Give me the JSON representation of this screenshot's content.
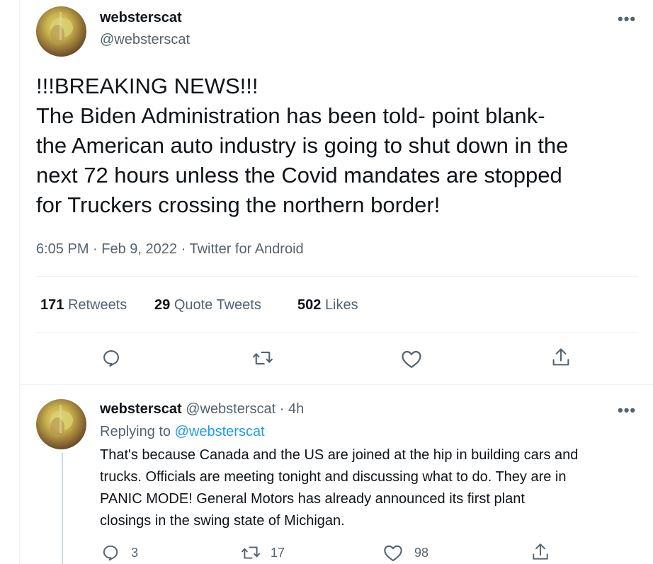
{
  "main_tweet": {
    "display_name": "websterscat",
    "handle": "@websterscat",
    "more_label": "•••",
    "text": "!!!BREAKING NEWS!!!\nThe Biden Administration has been told- point blank-\nthe American auto industry is going to shut down in the\nnext 72 hours unless the Covid mandates are stopped\nfor Truckers crossing the northern border!",
    "time": "6:05 PM",
    "date": "Feb 9, 2022",
    "source": "Twitter for Android",
    "separator": "·",
    "stats": {
      "retweets_count": "171",
      "retweets_label": "Retweets",
      "quotes_count": "29",
      "quotes_label": "Quote Tweets",
      "likes_count": "502",
      "likes_label": "Likes"
    }
  },
  "reply_tweet": {
    "display_name": "websterscat",
    "handle": "@websterscat",
    "separator": "·",
    "age": "4h",
    "more_label": "•••",
    "replying_prefix": "Replying to",
    "replying_handle": "@websterscat",
    "text_lines": [
      "That's because Canada and the US are joined at the hip in building cars and",
      "trucks. Officials are meeting tonight and discussing what to do. They are in",
      "PANIC MODE! General Motors has already announced its first plant",
      "closings in the swing state of Michigan."
    ],
    "reply_count": "3",
    "retweet_count": "17",
    "like_count": "98"
  },
  "icons": [
    "reply-icon",
    "retweet-icon",
    "like-icon",
    "share-icon",
    "more-icon"
  ],
  "colors": {
    "link": "#1d9bf0",
    "secondary_text": "#536471",
    "divider": "#eff3f4"
  }
}
